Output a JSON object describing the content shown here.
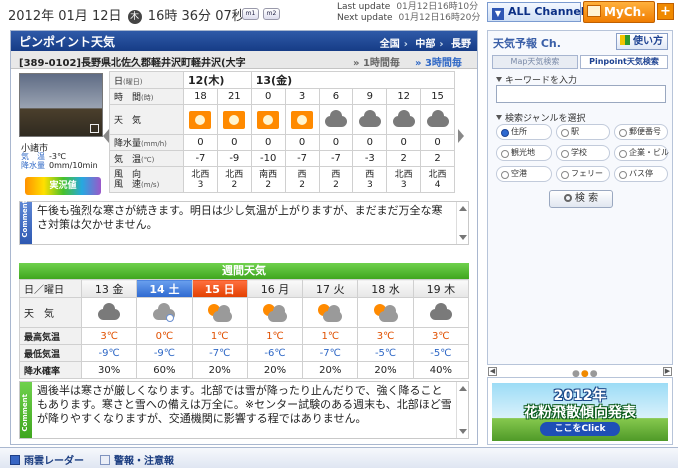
{
  "topbar": {
    "clock": {
      "year": "2012",
      "y_unit": "年",
      "month": "01",
      "m_unit": "月",
      "day": "12",
      "d_unit": "日",
      "weekday": "木",
      "hour": "16",
      "h_unit": "時",
      "minute": "36",
      "min_unit": "分",
      "second": "07",
      "s_unit": "秒"
    },
    "mini_buttons": [
      "m1",
      "m2"
    ],
    "last_update_label": "Last update",
    "last_update_value": "01月12日16時10分",
    "next_update_label": "Next update",
    "next_update_value": "01月12日16時20分",
    "all_channel": "ALL Channel",
    "mych": "MyCh.",
    "plus": "+"
  },
  "main": {
    "title": "ピンポイント天気",
    "breadcrumbs": [
      "全国",
      "中部",
      "長野"
    ],
    "location": "[389-0102]長野県北佐久郡軽井沢町軽井沢(大字",
    "hourly_1": "1時間毎",
    "hourly_3": "3時間毎",
    "camera": {
      "name": "小諸市",
      "temp_label": "気　温",
      "temp_value": "-3℃",
      "precip_label": "降水量",
      "precip_value": "0mm/10min",
      "live_label": "実況値"
    },
    "hourly": {
      "day_label": "日",
      "day_unit": "(曜日)",
      "days": [
        "12(木)",
        "13(金)"
      ],
      "time_label": "時　間",
      "time_unit": "(時)",
      "times": [
        "18",
        "21",
        "0",
        "3",
        "6",
        "9",
        "12",
        "15"
      ],
      "weather_label": "天　気",
      "weather": [
        "sun",
        "sun",
        "sun",
        "sun",
        "cloud",
        "cloud",
        "cloud",
        "cloud"
      ],
      "precip_label": "降水量",
      "precip_unit": "(mm/h)",
      "precip": [
        "0",
        "0",
        "0",
        "0",
        "0",
        "0",
        "0",
        "0"
      ],
      "temp_label": "気　温",
      "temp_unit": "(℃)",
      "temps": [
        "-7",
        "-9",
        "-10",
        "-7",
        "-7",
        "-3",
        "2",
        "2"
      ],
      "wind_label_1": "風　向",
      "wind_label_2": "風　速",
      "wind_unit": "(m/s)",
      "wind_dir": [
        "北西",
        "北西",
        "南西",
        "西",
        "西",
        "西",
        "北西",
        "北西"
      ],
      "wind_speed": [
        "3",
        "2",
        "2",
        "2",
        "2",
        "3",
        "3",
        "4"
      ]
    },
    "comment1": {
      "tag": "Comment",
      "text": "午後も強烈な寒さが続きます。明日は少し気温が上がりますが、まだまだ万全な寒さ対策は欠かせません。"
    },
    "weekly": {
      "header": "週間天気",
      "date_label": "日／曜日",
      "dates": [
        "13 金",
        "14 土",
        "15 日",
        "16 月",
        "17 火",
        "18 水",
        "19 木"
      ],
      "weather_label": "天　気",
      "weather": [
        "cloud",
        "cloud-snow",
        "sun-cloud",
        "sun-cloud",
        "sun-cloud",
        "sun-cloud",
        "cloud"
      ],
      "hi_label": "最高気温",
      "hi": [
        "3℃",
        "0℃",
        "1℃",
        "1℃",
        "1℃",
        "3℃",
        "3℃"
      ],
      "lo_label": "最低気温",
      "lo": [
        "-9℃",
        "-9℃",
        "-7℃",
        "-6℃",
        "-7℃",
        "-5℃",
        "-5℃"
      ],
      "prob_label": "降水確率",
      "prob": [
        "30%",
        "60%",
        "20%",
        "20%",
        "20%",
        "20%",
        "40%"
      ]
    },
    "comment2": {
      "tag": "Comment",
      "text": "週後半は寒さが厳しくなります。北部では雪が降ったり止んだりで、強く降ることもあります。寒さと雪への備えは万全に。※センター試験のある週末も、北部ほど雪が降りやすくなりますが、交通機関に影響する程ではありません。"
    }
  },
  "bottombar": {
    "link1": "雨雲レーダー",
    "link2": "警報・注意報"
  },
  "side": {
    "title": "天気予報 Ch.",
    "howto": "使い方",
    "tab_map": "Map天気検索",
    "tab_pinpoint": "Pinpoint天気検索",
    "keyword_label": "キーワードを入力",
    "keyword_value": "",
    "genre_label": "検索ジャンルを選択",
    "genres": [
      "住所",
      "駅",
      "郵便番号",
      "観光地",
      "学校",
      "企業・ビル",
      "空港",
      "フェリー",
      "バス停"
    ],
    "search_button": "検 索"
  },
  "banner": {
    "line1": "2012年",
    "line2": "花粉飛散傾向発表",
    "cta": "ここをClick"
  },
  "colors": {
    "header_blue": "#1f4a98",
    "week_green": "#48b028",
    "sat_blue": "#2e69d0",
    "holiday_red": "#e24000",
    "temp_high": "#e05000",
    "temp_low": "#2f68c6",
    "accent_orange": "#f08a00"
  }
}
